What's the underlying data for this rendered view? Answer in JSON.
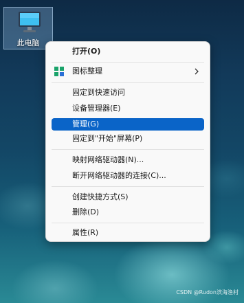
{
  "desktop": {
    "icon_label": "此电脑",
    "icon_name": "computer-icon"
  },
  "context_menu": {
    "items": [
      {
        "label": "打开(O)"
      },
      {
        "label": "图标整理",
        "icon": "grid-icon"
      },
      {
        "label": "固定到快速访问"
      },
      {
        "label": "设备管理器(E)"
      },
      {
        "label": "管理(G)"
      },
      {
        "label": "固定到\"开始\"屏幕(P)"
      },
      {
        "label": "映射网络驱动器(N)..."
      },
      {
        "label": "断开网络驱动器的连接(C)..."
      },
      {
        "label": "创建快捷方式(S)"
      },
      {
        "label": "删除(D)"
      },
      {
        "label": "属性(R)"
      }
    ],
    "selected_color": "#0a64c8"
  },
  "watermark": "CSDN @Rudon滨海渔村"
}
